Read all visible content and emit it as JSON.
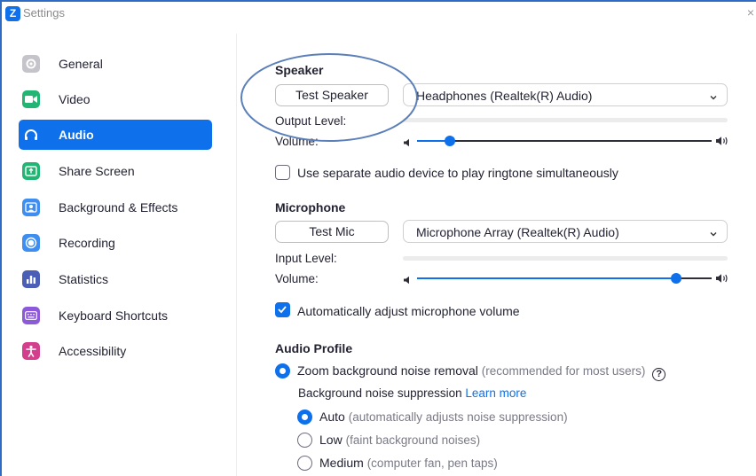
{
  "window": {
    "title": "Settings",
    "close": "×",
    "logo": "Z"
  },
  "sidebar": {
    "items": [
      {
        "label": "General",
        "icon": "gear-icon",
        "color": "#b9b9c0"
      },
      {
        "label": "Video",
        "icon": "video-camera-icon",
        "color": "#22b573"
      },
      {
        "label": "Audio",
        "icon": "headphones-icon",
        "color": "#0e71eb",
        "active": true
      },
      {
        "label": "Share Screen",
        "icon": "share-screen-icon",
        "color": "#22b573"
      },
      {
        "label": "Background & Effects",
        "icon": "person-background-icon",
        "color": "#3d8ef0"
      },
      {
        "label": "Recording",
        "icon": "record-icon",
        "color": "#3d8ef0"
      },
      {
        "label": "Statistics",
        "icon": "bar-chart-icon",
        "color": "#4a5fb5"
      },
      {
        "label": "Keyboard Shortcuts",
        "icon": "keyboard-icon",
        "color": "#8c5ad9"
      },
      {
        "label": "Accessibility",
        "icon": "accessibility-icon",
        "color": "#d43f8d"
      }
    ]
  },
  "speaker": {
    "title": "Speaker",
    "test_button": "Test Speaker",
    "device": "Headphones (Realtek(R) Audio)",
    "output_level_label": "Output Level:",
    "volume_label": "Volume:",
    "volume_level": 0.11
  },
  "ringtone": {
    "label": "Use separate audio device to play ringtone simultaneously",
    "checked": false
  },
  "microphone": {
    "title": "Microphone",
    "test_button": "Test Mic",
    "device": "Microphone Array (Realtek(R) Audio)",
    "input_level_label": "Input Level:",
    "volume_label": "Volume:",
    "volume_level": 0.88
  },
  "auto_adjust": {
    "label": "Automatically adjust microphone volume",
    "checked": true
  },
  "audio_profile": {
    "title": "Audio Profile",
    "zoom_noise_removal": {
      "label": "Zoom background noise removal",
      "hint": "(recommended for most users)",
      "help": "?",
      "checked": true
    },
    "suppression_label": "Background noise suppression",
    "learn_more": "Learn more",
    "options": [
      {
        "label": "Auto",
        "hint": "(automatically adjusts noise suppression)",
        "checked": true
      },
      {
        "label": "Low",
        "hint": "(faint background noises)",
        "checked": false
      },
      {
        "label": "Medium",
        "hint": "(computer fan, pen taps)",
        "checked": false
      }
    ]
  },
  "colors": {
    "accent": "#0e71eb",
    "annotation": "#5b7fb8"
  }
}
